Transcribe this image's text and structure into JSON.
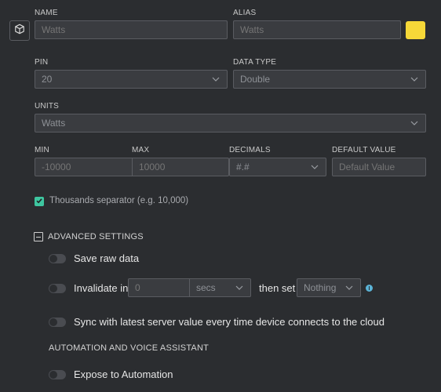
{
  "fields": {
    "name": {
      "label": "NAME",
      "placeholder": "Watts"
    },
    "alias": {
      "label": "ALIAS",
      "placeholder": "Watts"
    },
    "color": "#f6d838",
    "pin": {
      "label": "PIN",
      "value": "20"
    },
    "data_type": {
      "label": "DATA TYPE",
      "value": "Double"
    },
    "units": {
      "label": "UNITS",
      "value": "Watts"
    },
    "min": {
      "label": "MIN",
      "placeholder": "-10000"
    },
    "max": {
      "label": "MAX",
      "placeholder": "10000"
    },
    "decimals": {
      "label": "DECIMALS",
      "value": "#.#"
    },
    "default_value": {
      "label": "DEFAULT VALUE",
      "placeholder": "Default Value"
    }
  },
  "thousands_separator": {
    "label": "Thousands separator (e.g. 10,000)",
    "checked": true
  },
  "advanced": {
    "title": "ADVANCED SETTINGS",
    "save_raw": "Save raw data",
    "invalidate": {
      "prefix": "Invalidate in",
      "value_placeholder": "0",
      "unit": "secs",
      "then_set": "then set",
      "target": "Nothing"
    },
    "sync": "Sync with latest server value every time device connects to the cloud"
  },
  "automation": {
    "section_title": "AUTOMATION AND VOICE ASSISTANT",
    "expose": "Expose to Automation"
  },
  "icons": {
    "device": "cube-icon",
    "info": "info-icon",
    "collapse": "minus-square-icon"
  },
  "colors": {
    "accent": "#3ec6a0",
    "info": "#5bb3d6"
  }
}
